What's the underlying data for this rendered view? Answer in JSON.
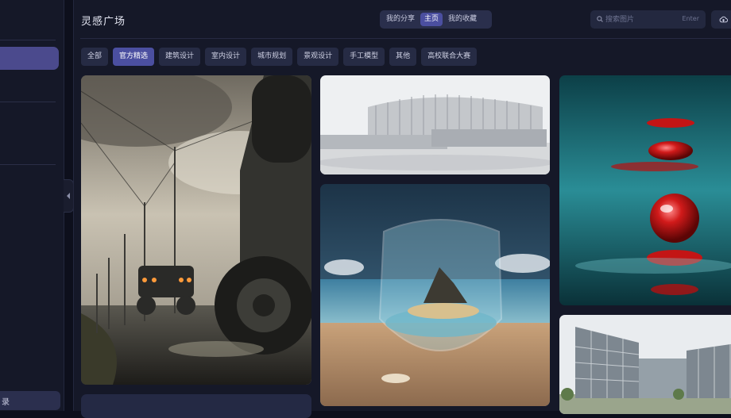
{
  "sidebar": {
    "login_label": "录"
  },
  "header": {
    "title": "灵感广场",
    "tabs": [
      "我的分享",
      "主页",
      "我的收藏"
    ],
    "active_tab": 1,
    "search": {
      "placeholder": "搜索图片",
      "hint": "Enter"
    }
  },
  "categories": [
    "全部",
    "官方精选",
    "建筑设计",
    "室内设计",
    "城市规划",
    "景观设计",
    "手工模型",
    "其他",
    "高校联合大赛"
  ],
  "active_category": 1,
  "gallery": [
    {
      "subject": "off-road vehicles beside power lines"
    },
    {
      "subject": "white modern building sketch"
    },
    {
      "subject": "island inside a glass on the beach"
    },
    {
      "subject": "red droplet over teal water"
    },
    {
      "subject": "glass office buildings"
    }
  ],
  "colors": {
    "accent": "#4b4fa0",
    "background": "#151828",
    "chip": "#262b44"
  }
}
